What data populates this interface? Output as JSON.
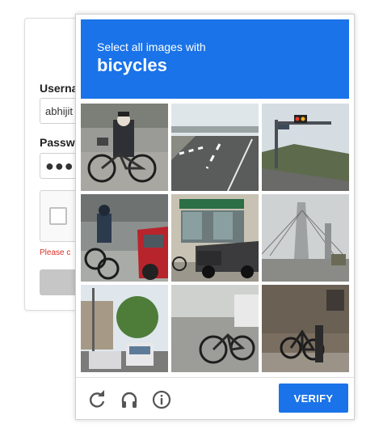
{
  "login": {
    "username_label": "Userna",
    "username_value": "abhijit",
    "password_label": "Passwo",
    "password_value": "●●●●",
    "error_text": "Please c"
  },
  "challenge": {
    "instruction": "Select all images with",
    "target": "bicycles",
    "accent_color": "#1a73e8",
    "tiles": [
      {
        "description": "person riding bicycle on street"
      },
      {
        "description": "highway road"
      },
      {
        "description": "traffic lights over highway"
      },
      {
        "description": "cyclist next to red car"
      },
      {
        "description": "storefront with pickup truck"
      },
      {
        "description": "cable-stayed bridge"
      },
      {
        "description": "street with buses and trees"
      },
      {
        "description": "bicycle parked on sidewalk"
      },
      {
        "description": "bicycles parked by wall"
      }
    ],
    "footer": {
      "reload_icon": "reload-icon",
      "audio_icon": "headphones-icon",
      "info_icon": "info-icon",
      "verify_label": "VERIFY"
    }
  }
}
